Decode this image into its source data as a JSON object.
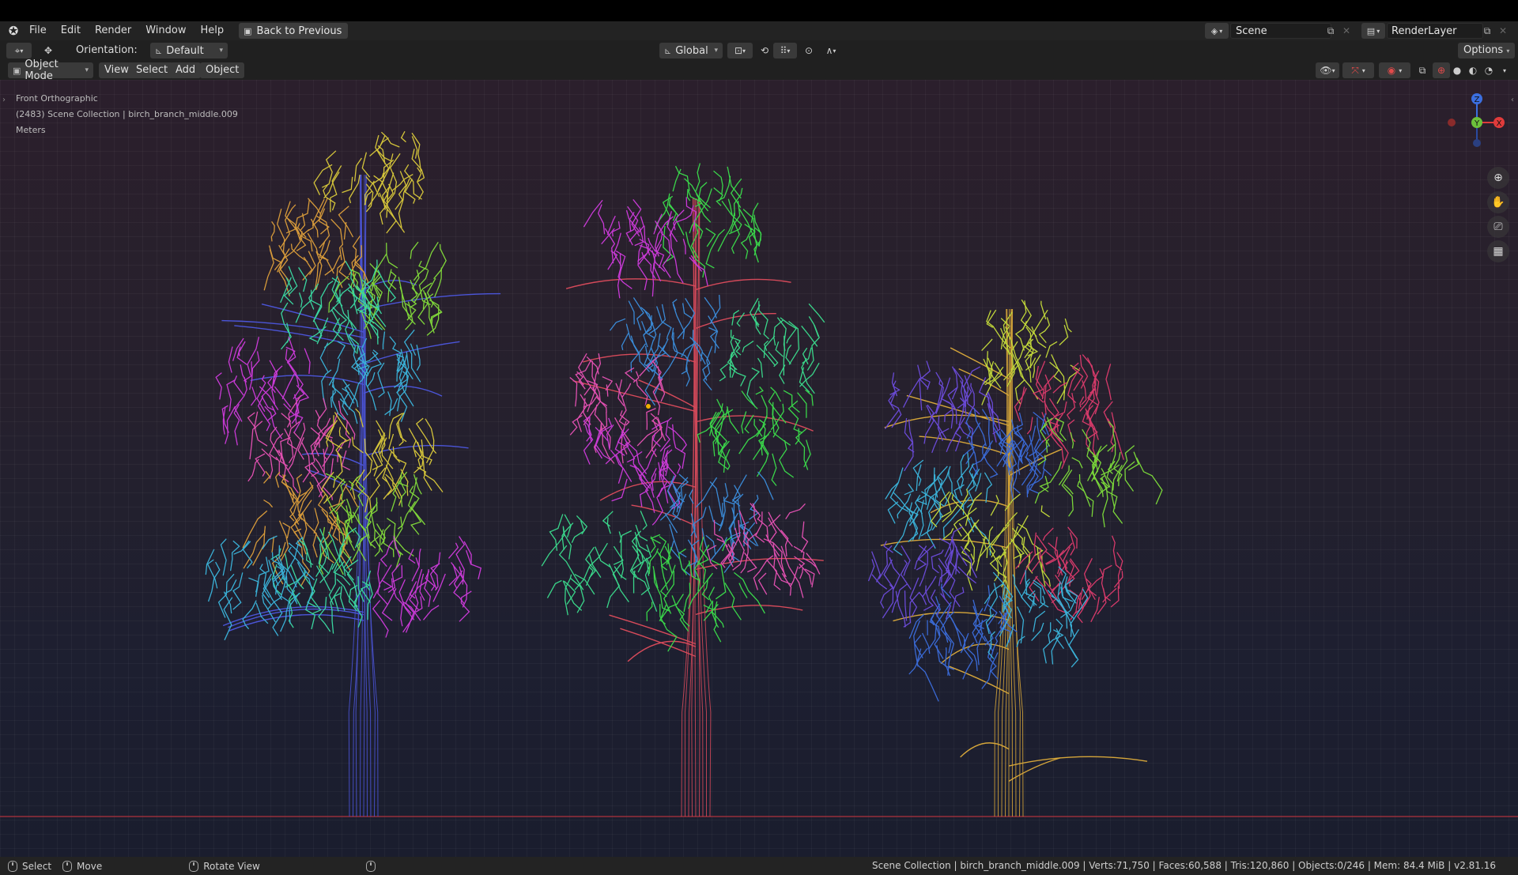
{
  "menubar": {
    "items": [
      "File",
      "Edit",
      "Render",
      "Window",
      "Help"
    ],
    "back_button": "Back to Previous",
    "scene": "Scene",
    "render_layer": "RenderLayer"
  },
  "header": {
    "orientation_label": "Orientation:",
    "orientation_value": "Default",
    "transform_space": "Global",
    "options": "Options",
    "mode": "Object Mode",
    "view": "View",
    "select": "Select",
    "add": "Add",
    "object": "Object"
  },
  "viewport": {
    "view_name": "Front Orthographic",
    "collection_info": "(2483) Scene Collection | birch_branch_middle.009",
    "units": "Meters",
    "gizmo": {
      "z": "Z",
      "y": "Y",
      "x": "X"
    },
    "trees": [
      {
        "name": "tree-left",
        "trunk_color": "#4b55d8",
        "clusters": [
          "#d4c43a",
          "#d69a3a",
          "#7fd63a",
          "#3ad6a0",
          "#c93ad6",
          "#3ab0d6",
          "#e050b0"
        ]
      },
      {
        "name": "tree-middle",
        "trunk_color": "#d64a5a",
        "clusters": [
          "#3ad64a",
          "#c93ad6",
          "#3a8ad6",
          "#3ad68a",
          "#e050b0"
        ]
      },
      {
        "name": "tree-right",
        "trunk_color": "#d6a63a",
        "clusters": [
          "#c0d63a",
          "#6a4ad6",
          "#d63a6a",
          "#3a6ad6",
          "#3ab0d6",
          "#7ad63a"
        ]
      }
    ]
  },
  "statusbar": {
    "select": "Select",
    "move": "Move",
    "rotate": "Rotate View",
    "stats": "Scene Collection | birch_branch_middle.009 | Verts:71,750 | Faces:60,588 | Tris:120,860 | Objects:0/246 | Mem: 84.4 MiB | v2.81.16"
  }
}
